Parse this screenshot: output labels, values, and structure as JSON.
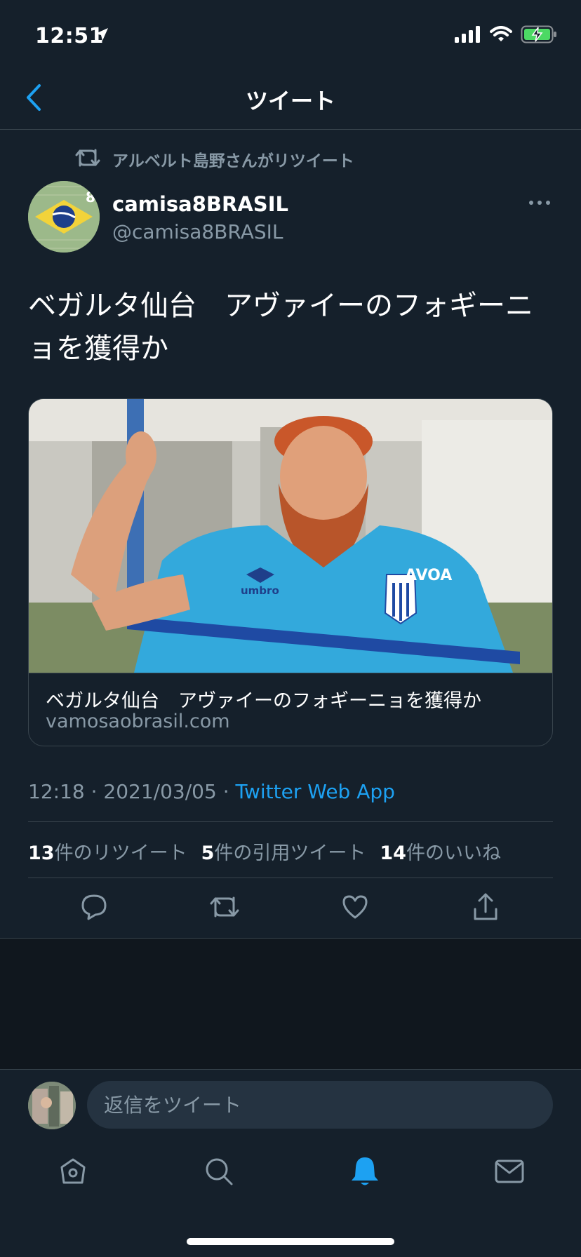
{
  "status_bar": {
    "time": "12:51",
    "icons": [
      "location-arrow-icon",
      "cellular-signal-icon",
      "wifi-icon",
      "battery-charging-icon"
    ]
  },
  "nav": {
    "title": "ツイート",
    "back_icon": "chevron-left-icon"
  },
  "tweet": {
    "retweeted_by": "アルベルト島野さんがリツイート",
    "author_name": "camisa8BRASIL",
    "author_handle": "@camisa8BRASIL",
    "avatar_badge": "8",
    "text_line1": "ベガルタ仙台　アヴァイーのフォギーニ",
    "text_line2": "ョを獲得か",
    "card": {
      "title": "ベガルタ仙台　アヴァイーのフォギーニョを獲得か",
      "domain": "vamosaobrasil.com",
      "jersey_text_1": "umbro",
      "jersey_text_2": "AVOA"
    },
    "time": "12:18",
    "date": "2021/03/05",
    "separator": "·",
    "source": "Twitter Web App",
    "stats": {
      "retweets_count": "13",
      "retweets_label": "件のリツイート",
      "quotes_count": "5",
      "quotes_label": "件の引用ツイート",
      "likes_count": "14",
      "likes_label": "件のいいね"
    }
  },
  "actions": [
    "reply-icon",
    "retweet-icon",
    "like-icon",
    "share-icon"
  ],
  "reply": {
    "placeholder": "返信をツイート"
  },
  "tabbar": {
    "items": [
      "home-icon",
      "search-icon",
      "notifications-icon",
      "messages-icon"
    ],
    "active": "notifications-icon"
  },
  "colors": {
    "background": "#15202b",
    "lower_background": "#10171e",
    "accent": "#1da1f2",
    "secondary_text": "#8899a6",
    "divider": "#38444d"
  }
}
